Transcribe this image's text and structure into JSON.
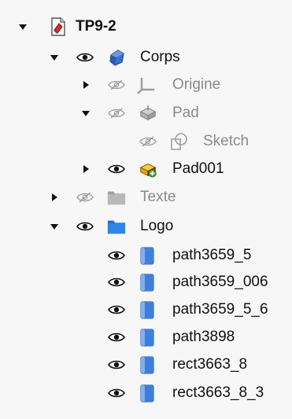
{
  "tree": {
    "root": {
      "label": "TP9-2"
    },
    "corps": {
      "label": "Corps"
    },
    "origine": {
      "label": "Origine"
    },
    "pad": {
      "label": "Pad"
    },
    "sketch": {
      "label": "Sketch"
    },
    "pad001": {
      "label": "Pad001"
    },
    "texte": {
      "label": "Texte"
    },
    "logo": {
      "label": "Logo"
    },
    "logo_children": [
      {
        "label": "path3659_5"
      },
      {
        "label": "path3659_006"
      },
      {
        "label": "path3659_5_6"
      },
      {
        "label": "path3898"
      },
      {
        "label": "rect3663_8"
      },
      {
        "label": "rect3663_8_3"
      }
    ]
  },
  "icons": {
    "expanded": "arrow-expanded-icon",
    "collapsed": "arrow-collapsed-icon",
    "visible": "eye-icon",
    "hidden": "eye-hidden-icon",
    "document": "document-icon",
    "body": "body-icon",
    "origin": "origin-icon",
    "pad": "pad-icon",
    "sketch": "sketch-icon",
    "folder": "folder-icon",
    "part": "part-cube-icon"
  },
  "colors": {
    "background": "#f7f7f7",
    "text": "#111111",
    "dimmed_text": "#8a8a8a",
    "folder_blue": "#2f7fd3",
    "cube_blue": "#3a7bd5"
  }
}
